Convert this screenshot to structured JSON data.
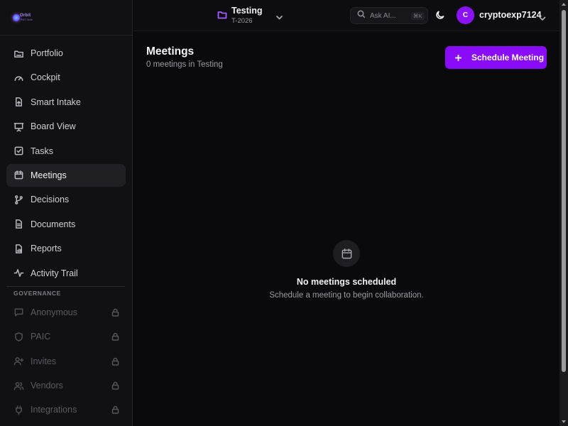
{
  "app": {
    "logo_text": "Orbit",
    "logo_sub": "PMO Suite"
  },
  "sidebar": {
    "items": [
      {
        "label": "Portfolio",
        "icon": "folder-icon",
        "active": false
      },
      {
        "label": "Cockpit",
        "icon": "gauge-icon",
        "active": false
      },
      {
        "label": "Smart Intake",
        "icon": "file-upload-icon",
        "active": false
      },
      {
        "label": "Board View",
        "icon": "presentation-icon",
        "active": false
      },
      {
        "label": "Tasks",
        "icon": "checkbox-icon",
        "active": false
      },
      {
        "label": "Meetings",
        "icon": "calendar-icon",
        "active": true
      },
      {
        "label": "Decisions",
        "icon": "git-branch-icon",
        "active": false
      },
      {
        "label": "Documents",
        "icon": "document-icon",
        "active": false
      },
      {
        "label": "Reports",
        "icon": "bar-chart-icon",
        "active": false
      },
      {
        "label": "Activity Trail",
        "icon": "activity-icon",
        "active": false
      }
    ],
    "governance_label": "GOVERNANCE",
    "governance_items": [
      {
        "label": "Anonymous",
        "icon": "message-icon",
        "locked": true
      },
      {
        "label": "PAIC",
        "icon": "shield-icon",
        "locked": true
      },
      {
        "label": "Invites",
        "icon": "user-plus-icon",
        "locked": true
      },
      {
        "label": "Vendors",
        "icon": "users-icon",
        "locked": true
      },
      {
        "label": "Integrations",
        "icon": "plug-icon",
        "locked": true
      }
    ]
  },
  "topbar": {
    "project_name": "Testing",
    "project_code": "T-2026",
    "search_placeholder": "Ask AI...",
    "search_shortcut": "⌘K",
    "avatar_initial": "C",
    "username": "cryptoexp7124"
  },
  "main": {
    "title": "Meetings",
    "subtitle": "0 meetings in Testing",
    "schedule_button": "Schedule Meeting",
    "empty_title": "No meetings scheduled",
    "empty_description": "Schedule a meeting to begin collaboration."
  },
  "colors": {
    "accent": "#8a0bf7",
    "background": "#0a090c",
    "sidebar": "#111113"
  }
}
